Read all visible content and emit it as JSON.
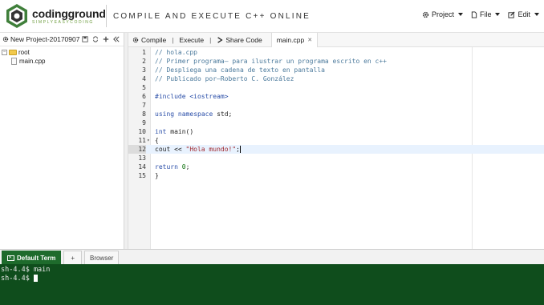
{
  "header": {
    "logo_word": "codingground",
    "logo_sub": "SIMPLYEASYCODING",
    "tagline": "COMPILE AND EXECUTE C++ ONLINE",
    "menu": [
      {
        "label": "Project",
        "icon": "gear-icon"
      },
      {
        "label": "File",
        "icon": "file-icon"
      },
      {
        "label": "Edit",
        "icon": "edit-icon"
      }
    ]
  },
  "project": {
    "name": "New Project-20170907",
    "tree": {
      "root_label": "root",
      "files": [
        "main.cpp"
      ]
    }
  },
  "toolbar": {
    "compile_label": "Compile",
    "execute_label": "Execute",
    "share_label": "Share Code",
    "file_tab_label": "main.cpp"
  },
  "editor": {
    "active_line": 12,
    "line_numbers": [
      "1",
      "2",
      "3",
      "4",
      "5",
      "6",
      "7",
      "8",
      "9",
      "10",
      "11",
      "12",
      "13",
      "14",
      "15"
    ],
    "lines": [
      "// hola.cpp",
      "// Primer programa– para ilustrar un programa escrito en c++",
      "// Despliega una cadena de texto en pantalla",
      "// Publicado por–Roberto C. González",
      "",
      "#include <iostream>",
      "",
      "using namespace std;",
      "",
      "int main()",
      "{",
      "cout << \"Hola mundo!\";",
      "",
      "return 0;",
      "}"
    ]
  },
  "terminal": {
    "tabs": [
      "Default Term",
      "+",
      "Browser"
    ],
    "lines": [
      "sh-4.4$ main",
      "sh-4.4$ "
    ]
  }
}
